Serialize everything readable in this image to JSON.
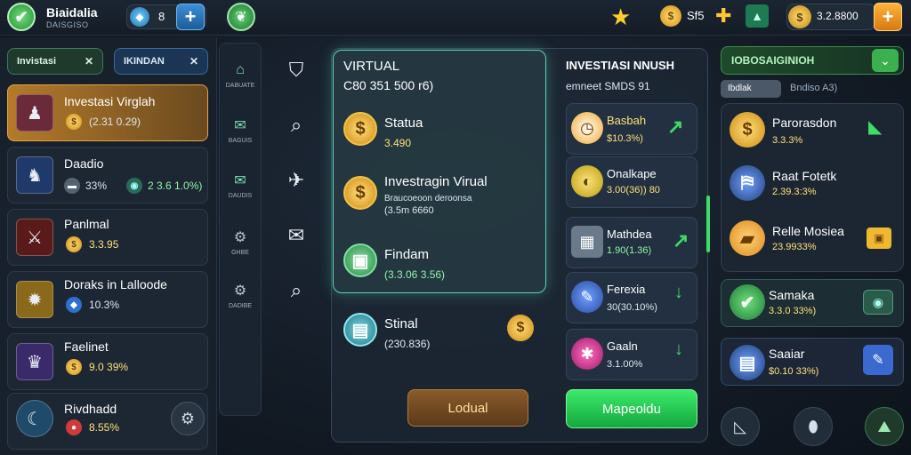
{
  "topbar": {
    "brand_title": "Biaidalia",
    "brand_sub": "DAISGISO",
    "gem_count": "8",
    "coin_count": "Sf5",
    "money": "3.2.8800"
  },
  "left_tabs": [
    {
      "label": "Invistasi",
      "close": "✕"
    },
    {
      "label": "IKINDAN",
      "close": "✕"
    }
  ],
  "left_list": [
    {
      "name": "Investasi Virglah",
      "val1": "(2.31 0.29)",
      "val2": ""
    },
    {
      "name": "Daadio",
      "val1": "33%",
      "val2": "2 3.6 1.0%)"
    },
    {
      "name": "Panlmal",
      "val1": "3.3.95",
      "val2": ""
    },
    {
      "name": "Doraks in Lalloode",
      "val1": "10.3%",
      "val2": ""
    },
    {
      "name": "Faelinet",
      "val1": "9.0 39%",
      "val2": ""
    },
    {
      "name": "Rivdhadd",
      "val1": "8.55%",
      "val2": ""
    }
  ],
  "nav": [
    {
      "icon": "home-icon",
      "label": "DABUATE"
    },
    {
      "icon": "mail-icon",
      "label": "BAGUIS"
    },
    {
      "icon": "mail-icon",
      "label": "DAUDIS"
    },
    {
      "icon": "gear-icon",
      "label": "GHBE"
    },
    {
      "icon": "gear-icon",
      "label": "DADIBE"
    }
  ],
  "virtual_panel": {
    "title": "VIRTUAL",
    "subtitle": "C80 351 500 r6)",
    "items": [
      {
        "name": "Statua",
        "val": "3.490"
      },
      {
        "name": "Investragin Virual",
        "val": "Braucoeoon deroonsa",
        "val2": "(3.5m 6660"
      },
      {
        "name": "Findam",
        "val": "(3.3.06 3.56)"
      }
    ]
  },
  "bottom_item": {
    "name": "Stinal",
    "val": "(230.836)"
  },
  "right_list": {
    "title": "INVESTIASI NNUSH",
    "subtitle": "emneet SMDS 91",
    "items": [
      {
        "name": "Basbah",
        "val": "$10.3%)"
      },
      {
        "name": "Onalkape",
        "val": "3.00(36)) 80"
      },
      {
        "name": "Mathdea",
        "val": "1.90(1.36)"
      },
      {
        "name": "Ferexia",
        "val": "30(30.10%)"
      },
      {
        "name": "Gaaln",
        "val": "3.1.00%"
      }
    ]
  },
  "buttons": {
    "brown": "Lodual",
    "green": "Mapeoldu"
  },
  "right_panel": {
    "head": "IOBOSAIGINIOH",
    "tab1": "Ibdlak",
    "tab2": "Bndiso A3)",
    "items": [
      {
        "name": "Parorasdon",
        "val": "3.3.3%"
      },
      {
        "name": "Raat Fotetk",
        "val": "2.39.3:3%"
      },
      {
        "name": "Relle Mosiea",
        "val": "23.9933%"
      }
    ],
    "cards": [
      {
        "name": "Samaka",
        "val": "3.3.0 33%)"
      },
      {
        "name": "Saaiar",
        "val": "$0.10 33%)"
      }
    ]
  },
  "colors": {
    "accent_green": "#3bea6a",
    "accent_gold": "#ffc634",
    "panel_glow": "#5ad3b6"
  }
}
